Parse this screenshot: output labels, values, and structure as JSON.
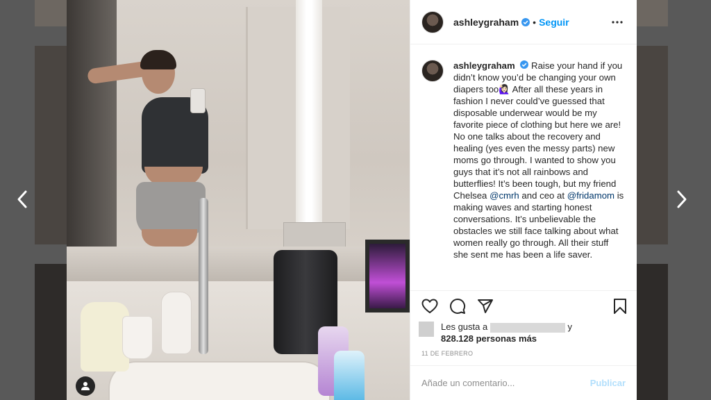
{
  "post": {
    "username": "ashleygraham",
    "follow_label": "Seguir",
    "separator": "•",
    "caption": {
      "username": "ashleygraham",
      "part1": "Raise your hand if you didn’t know you’d be changing your own diapers too🙋🏻‍♀️ After all these years in fashion I never could’ve guessed that disposable underwear would be my favorite piece of clothing but here we are! No one talks about the recovery and healing (yes even the messy parts) new moms go through. I wanted to show you guys that it’s not all rainbows and butterflies! It’s been tough, but my friend Chelsea ",
      "mention1": "@cmrh",
      "part2": " and ceo at ",
      "mention2": "@fridamom",
      "part3": " is making waves and starting honest conversations. It’s unbelievable the obstacles we still face talking about what women really go through. All their stuff she sent me has been a life saver."
    },
    "likes": {
      "prefix": "Les gusta a",
      "suffix": "y",
      "count_text": "828.128 personas más"
    },
    "date": "11 DE FEBRERO",
    "comment_placeholder": "Añade un comentario...",
    "publish_label": "Publicar"
  },
  "icons": {
    "verified": "verified-badge-icon",
    "more": "more-options-icon",
    "like": "heart-icon",
    "comment": "comment-icon",
    "share": "share-icon",
    "save": "bookmark-icon",
    "prev": "chevron-left-icon",
    "next": "chevron-right-icon",
    "tag": "user-tag-icon"
  },
  "colors": {
    "accent": "#0095f6",
    "publish_disabled": "#b2dffc",
    "text": "#262626",
    "muted": "#8e8e8e"
  }
}
